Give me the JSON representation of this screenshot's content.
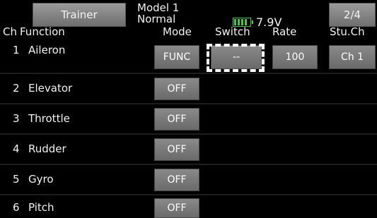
{
  "header": {
    "title_button": "Trainer",
    "model_line1": "Model 1",
    "model_line2": "Normal",
    "battery_voltage": "7.9V",
    "battery_level": 1.0,
    "page_indicator": "2/4"
  },
  "columns": {
    "ch": "Ch",
    "function": "Function",
    "mode": "Mode",
    "switch": "Switch",
    "rate": "Rate",
    "stu_ch": "Stu.Ch"
  },
  "rows": [
    {
      "num": "1",
      "name": "Aileron",
      "mode": "FUNC",
      "switch": "--",
      "rate": "100",
      "stu_ch": "Ch 1"
    },
    {
      "num": "2",
      "name": "Elevator",
      "mode": "OFF"
    },
    {
      "num": "3",
      "name": "Throttle",
      "mode": "OFF"
    },
    {
      "num": "4",
      "name": "Rudder",
      "mode": "OFF"
    },
    {
      "num": "5",
      "name": "Gyro",
      "mode": "OFF"
    },
    {
      "num": "6",
      "name": "Pitch",
      "mode": "OFF"
    }
  ]
}
